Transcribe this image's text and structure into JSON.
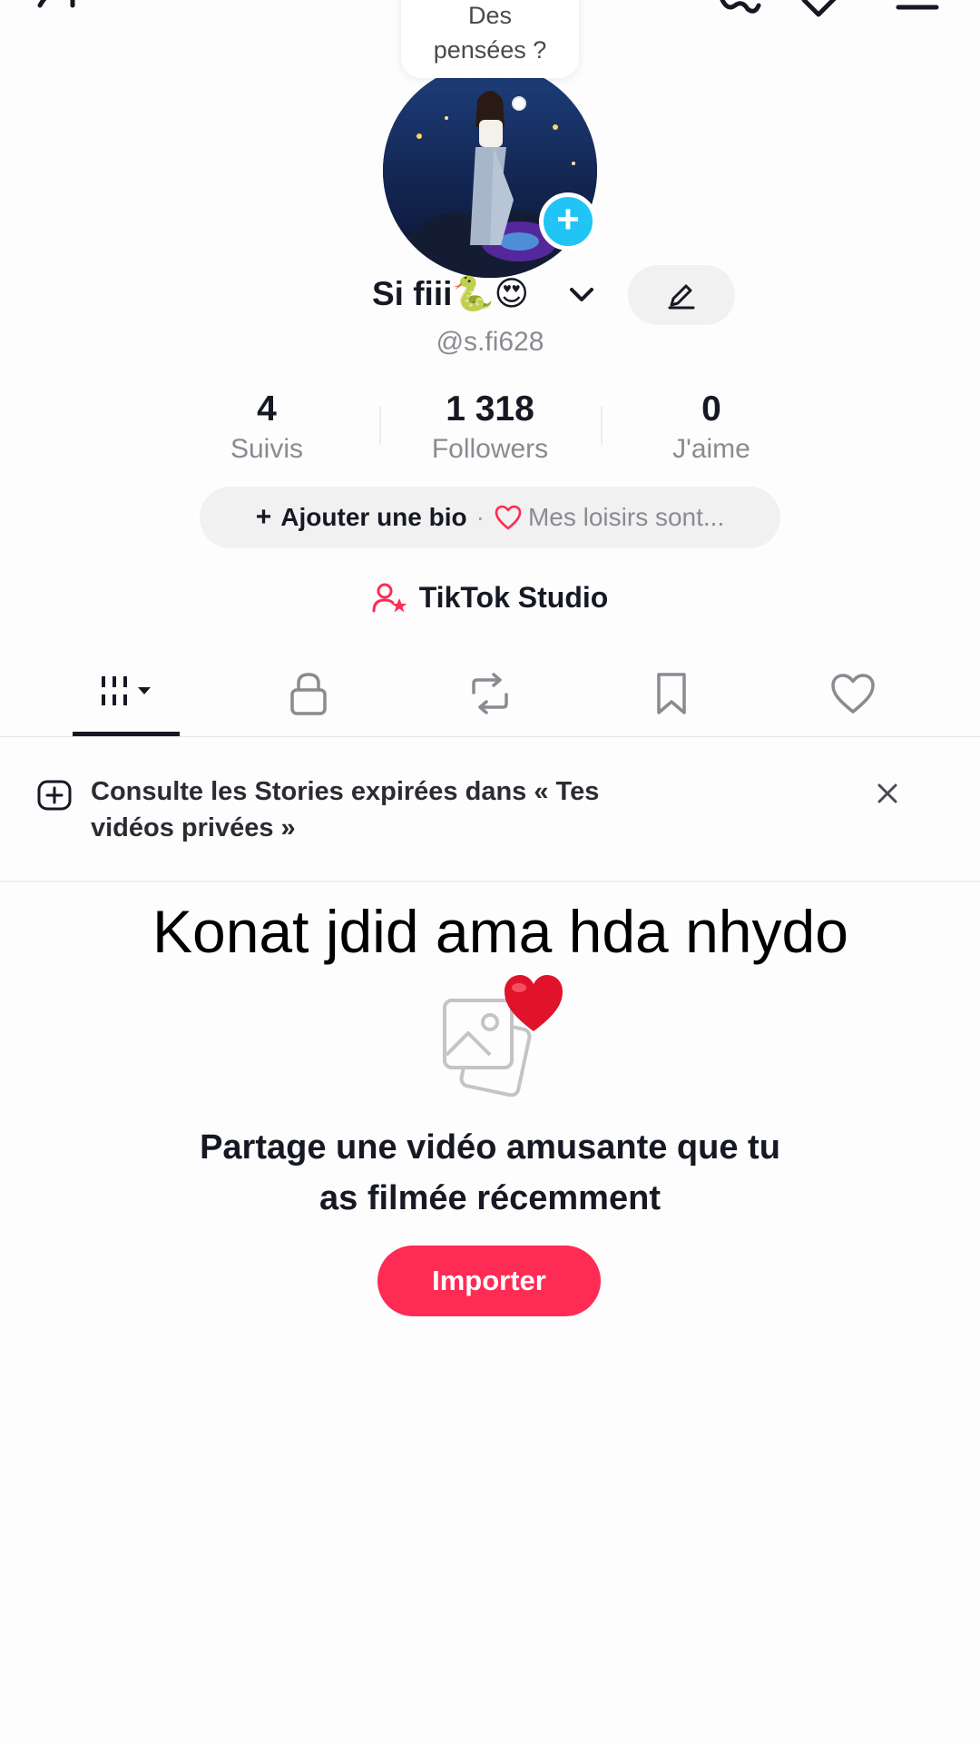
{
  "profile": {
    "thought_bubble": "Des\npensées ?",
    "thought_line1": "Des",
    "thought_line2": "pensées ?",
    "display_name": "Si fiii🐍😍",
    "username": "@s.fi628"
  },
  "stats": [
    {
      "value": "4",
      "label": "Suivis"
    },
    {
      "value": "1 318",
      "label": "Followers"
    },
    {
      "value": "0",
      "label": "J'aime"
    }
  ],
  "bio": {
    "add_label": "Ajouter une bio",
    "separator": "·",
    "hint": "Mes loisirs sont..."
  },
  "studio_label": "TikTok Studio",
  "tabs": [
    {
      "icon": "grid-icon",
      "active": true
    },
    {
      "icon": "lock-icon",
      "active": false
    },
    {
      "icon": "repost-icon",
      "active": false
    },
    {
      "icon": "bookmark-icon",
      "active": false
    },
    {
      "icon": "heart-icon",
      "active": false
    }
  ],
  "notice": {
    "line1": "Consulte les Stories expirées dans « Tes",
    "line2": "vidéos privées »"
  },
  "overlay_caption": "Konat jdid ama hda nhydo",
  "empty_state": {
    "line1": "Partage une vidéo amusante que tu",
    "line2": "as filmée récemment",
    "button_label": "Importer"
  },
  "colors": {
    "accent": "#fe2c55",
    "avatar_plus": "#20c5f5",
    "text_primary": "#161823",
    "text_secondary": "#8a8b91"
  }
}
